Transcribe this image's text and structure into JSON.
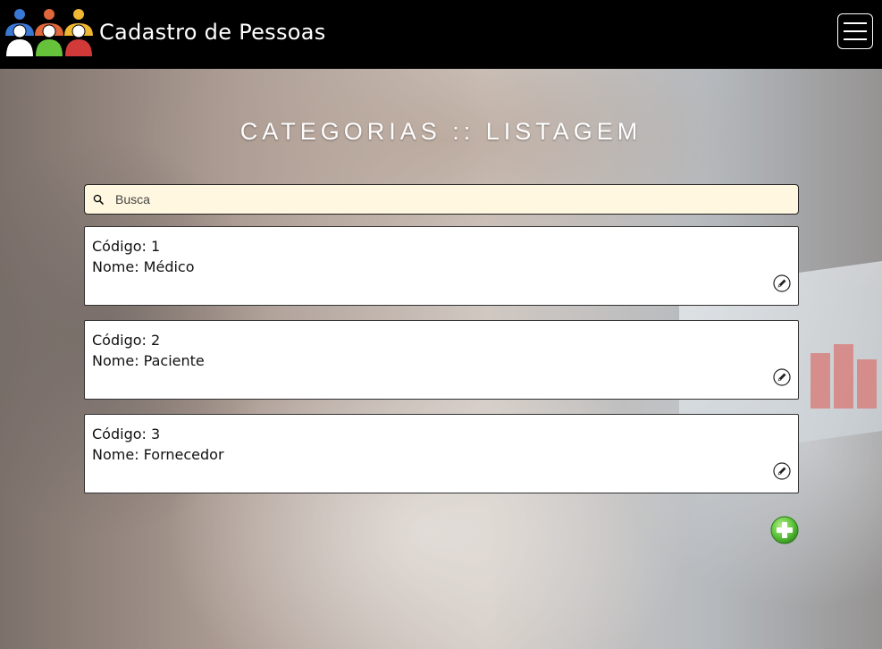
{
  "header": {
    "brand": "Cadastro de Pessoas",
    "logo_icon": "people-group-logo-icon",
    "menu_icon": "hamburger-menu-icon"
  },
  "page": {
    "title": "CATEGORIAS :: LISTAGEM"
  },
  "search": {
    "placeholder": "Busca",
    "value": "",
    "icon": "search-icon"
  },
  "items": [
    {
      "code_label": "Código:",
      "code": "1",
      "name_label": "Nome:",
      "name": "Médico"
    },
    {
      "code_label": "Código:",
      "code": "2",
      "name_label": "Nome:",
      "name": "Paciente"
    },
    {
      "code_label": "Código:",
      "code": "3",
      "name_label": "Nome:",
      "name": "Fornecedor"
    }
  ],
  "actions": {
    "edit_icon": "pencil-edit-icon",
    "add_icon": "plus-add-icon"
  },
  "colors": {
    "navbar": "#000000",
    "search_bg": "#fff7e0",
    "add_green": "#5cc33a",
    "logo_blue": "#3a78d6",
    "logo_orange": "#e0673a",
    "logo_green": "#66c23a",
    "logo_red": "#d23a3a",
    "logo_yellow": "#f0b832"
  }
}
